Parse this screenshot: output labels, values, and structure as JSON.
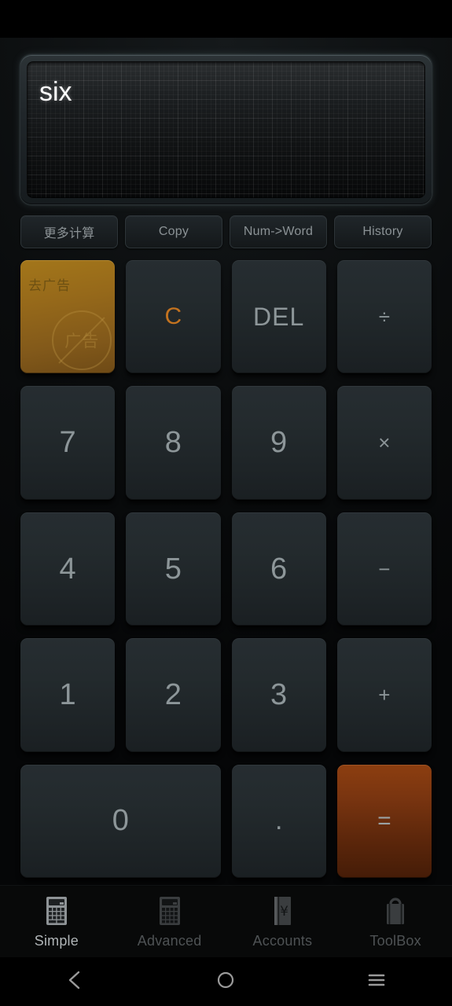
{
  "app": {
    "title": "Calculator",
    "accent_orange": "#c4731f",
    "equals_bg": "#7a3510",
    "ad_bg": "#96691a",
    "key_bg": "#232a2d",
    "key_text": "#8d9699",
    "display_text_color": "#ffffff"
  },
  "display": {
    "value": "six"
  },
  "toolbar": {
    "buttons": [
      {
        "label": "更多计算",
        "name": "more-calc"
      },
      {
        "label": "Copy",
        "name": "copy"
      },
      {
        "label": "Num->Word",
        "name": "num-to-word"
      },
      {
        "label": "History",
        "name": "history"
      }
    ]
  },
  "keypad": {
    "rows": [
      [
        {
          "label": "去广告",
          "badge": "广告",
          "kind": "ad"
        },
        {
          "label": "C",
          "kind": "clear"
        },
        {
          "label": "DEL",
          "kind": "del"
        },
        {
          "label": "÷",
          "kind": "op"
        }
      ],
      [
        {
          "label": "7",
          "kind": "digit"
        },
        {
          "label": "8",
          "kind": "digit"
        },
        {
          "label": "9",
          "kind": "digit"
        },
        {
          "label": "×",
          "kind": "op"
        }
      ],
      [
        {
          "label": "4",
          "kind": "digit"
        },
        {
          "label": "5",
          "kind": "digit"
        },
        {
          "label": "6",
          "kind": "digit"
        },
        {
          "label": "−",
          "kind": "op"
        }
      ],
      [
        {
          "label": "1",
          "kind": "digit"
        },
        {
          "label": "2",
          "kind": "digit"
        },
        {
          "label": "3",
          "kind": "digit"
        },
        {
          "label": "+",
          "kind": "op"
        }
      ],
      [
        {
          "label": "0",
          "kind": "digit wide"
        },
        {
          "label": ".",
          "kind": "dot"
        },
        {
          "label": "=",
          "kind": "equals"
        }
      ]
    ]
  },
  "tabbar": {
    "items": [
      {
        "label": "Simple",
        "icon": "calculator-icon",
        "active": true
      },
      {
        "label": "Advanced",
        "icon": "calculator-grid-icon",
        "active": false
      },
      {
        "label": "Accounts",
        "icon": "yen-ledger-icon",
        "active": false
      },
      {
        "label": "ToolBox",
        "icon": "toolbag-icon",
        "active": false
      }
    ]
  },
  "navbar": {
    "back": "back-icon",
    "home": "home-icon",
    "menu": "menu-icon"
  }
}
